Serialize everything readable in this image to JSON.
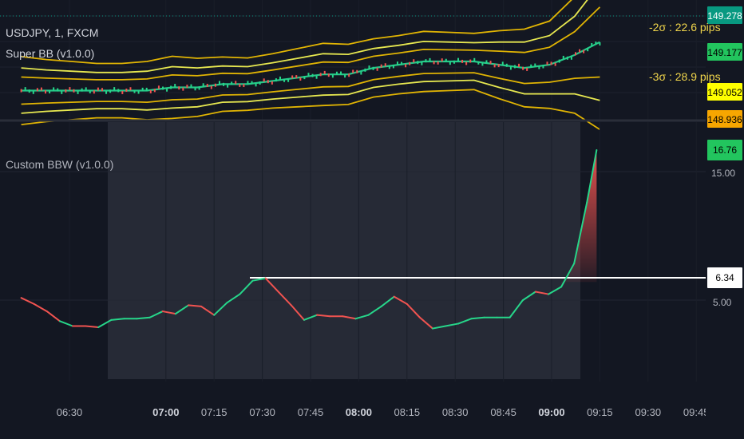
{
  "upper_pane": {
    "symbol": "USDJPY, 1, FXCM",
    "indicator": "Super BB (v1.0.0)",
    "pips": [
      {
        "label": "-2σ :  22.6 pips"
      },
      {
        "label": "-3σ :  28.9 pips"
      }
    ],
    "price_tags": [
      {
        "value": "149.278",
        "bg": "#089981",
        "fg": "#ffffff"
      },
      {
        "value": "149.177",
        "bg": "#22c55e",
        "fg": "#000000"
      },
      {
        "value": "149.052",
        "bg": "#ffff00",
        "fg": "#000000"
      },
      {
        "value": "148.936",
        "bg": "#f7a600",
        "fg": "#000000"
      }
    ]
  },
  "lower_pane": {
    "indicator": "Custom BBW (v1.0.0)",
    "axis_label": "15.00",
    "axis_label_lower": "5.00",
    "tags": [
      {
        "value": "16.76",
        "bg": "#22c55e",
        "fg": "#000000"
      },
      {
        "value": "6.34",
        "bg": "#ffffff",
        "fg": "#000000"
      }
    ],
    "highlight_level": 6.34
  },
  "colors": {
    "background": "#131722",
    "rising": "#26d68a",
    "falling": "#f05350",
    "band_outer": "#f7c500",
    "band_inner": "#ffff55",
    "basis": "#26c98a",
    "highlight": "#ffffff",
    "selection": "#2a2e39"
  },
  "chart_data": {
    "type": "line",
    "x_ticks": [
      {
        "label": "06:30",
        "bold": false
      },
      {
        "label": "07:00",
        "bold": true
      },
      {
        "label": "07:15",
        "bold": false
      },
      {
        "label": "07:30",
        "bold": false
      },
      {
        "label": "07:45",
        "bold": false
      },
      {
        "label": "08:00",
        "bold": true
      },
      {
        "label": "08:15",
        "bold": false
      },
      {
        "label": "08:30",
        "bold": false
      },
      {
        "label": "08:45",
        "bold": false
      },
      {
        "label": "09:00",
        "bold": true
      },
      {
        "label": "09:15",
        "bold": false
      },
      {
        "label": "09:30",
        "bold": false
      },
      {
        "label": "09:45",
        "bold": false
      }
    ],
    "bbw_series": {
      "name": "",
      "x": [
        "06:15",
        "06:19",
        "06:23",
        "06:27",
        "06:31",
        "06:35",
        "06:39",
        "06:43",
        "06:47",
        "06:51",
        "06:55",
        "06:59",
        "07:03",
        "07:07",
        "07:11",
        "07:15",
        "07:19",
        "07:23",
        "07:27",
        "07:31",
        "07:35",
        "07:39",
        "07:43",
        "07:47",
        "07:51",
        "07:55",
        "07:59",
        "08:03",
        "08:07",
        "08:11",
        "08:15",
        "08:19",
        "08:23",
        "08:27",
        "08:31",
        "08:35",
        "08:39",
        "08:43",
        "08:47",
        "08:51",
        "08:55",
        "08:59",
        "09:03",
        "09:07",
        "09:11",
        "09:14"
      ],
      "values": [
        4.7,
        4.2,
        3.6,
        2.8,
        2.4,
        2.4,
        2.3,
        2.9,
        3.0,
        3.0,
        3.1,
        3.6,
        3.4,
        4.1,
        4.0,
        3.3,
        4.3,
        5.0,
        6.1,
        6.3,
        5.2,
        4.1,
        2.9,
        3.3,
        3.2,
        3.2,
        3.0,
        3.3,
        4.0,
        4.8,
        4.2,
        3.1,
        2.2,
        2.4,
        2.6,
        3.0,
        3.1,
        3.1,
        3.1,
        4.5,
        5.2,
        5.0,
        5.6,
        7.5,
        12.5,
        16.76
      ],
      "rising_flags": [
        false,
        false,
        false,
        false,
        true,
        false,
        false,
        true,
        true,
        true,
        true,
        true,
        false,
        true,
        false,
        false,
        true,
        true,
        true,
        true,
        false,
        false,
        false,
        true,
        false,
        false,
        false,
        true,
        true,
        true,
        false,
        false,
        false,
        true,
        true,
        true,
        true,
        true,
        true,
        true,
        true,
        false,
        true,
        true,
        true,
        true
      ]
    },
    "upper_series": {
      "x_range": [
        "06:15",
        "09:15"
      ],
      "basis": [
        149.02,
        149.02,
        149.02,
        149.02,
        149.02,
        149.02,
        149.03,
        149.03,
        149.04,
        149.04,
        149.05,
        149.06,
        149.07,
        149.07,
        149.09,
        149.1,
        149.11,
        149.11,
        149.11,
        149.1,
        149.09,
        149.1,
        149.13,
        149.17
      ],
      "ylim": [
        148.93,
        149.3
      ]
    },
    "ylim": [
      0,
      18
    ]
  }
}
